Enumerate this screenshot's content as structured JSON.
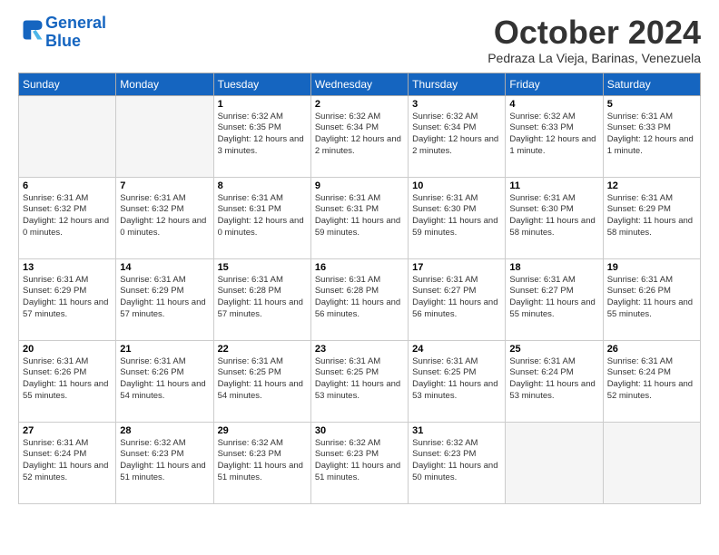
{
  "header": {
    "logo_line1": "General",
    "logo_line2": "Blue",
    "month": "October 2024",
    "location": "Pedraza La Vieja, Barinas, Venezuela"
  },
  "weekdays": [
    "Sunday",
    "Monday",
    "Tuesday",
    "Wednesday",
    "Thursday",
    "Friday",
    "Saturday"
  ],
  "weeks": [
    [
      {
        "day": "",
        "info": ""
      },
      {
        "day": "",
        "info": ""
      },
      {
        "day": "1",
        "info": "Sunrise: 6:32 AM\nSunset: 6:35 PM\nDaylight: 12 hours and 3 minutes."
      },
      {
        "day": "2",
        "info": "Sunrise: 6:32 AM\nSunset: 6:34 PM\nDaylight: 12 hours and 2 minutes."
      },
      {
        "day": "3",
        "info": "Sunrise: 6:32 AM\nSunset: 6:34 PM\nDaylight: 12 hours and 2 minutes."
      },
      {
        "day": "4",
        "info": "Sunrise: 6:32 AM\nSunset: 6:33 PM\nDaylight: 12 hours and 1 minute."
      },
      {
        "day": "5",
        "info": "Sunrise: 6:31 AM\nSunset: 6:33 PM\nDaylight: 12 hours and 1 minute."
      }
    ],
    [
      {
        "day": "6",
        "info": "Sunrise: 6:31 AM\nSunset: 6:32 PM\nDaylight: 12 hours and 0 minutes."
      },
      {
        "day": "7",
        "info": "Sunrise: 6:31 AM\nSunset: 6:32 PM\nDaylight: 12 hours and 0 minutes."
      },
      {
        "day": "8",
        "info": "Sunrise: 6:31 AM\nSunset: 6:31 PM\nDaylight: 12 hours and 0 minutes."
      },
      {
        "day": "9",
        "info": "Sunrise: 6:31 AM\nSunset: 6:31 PM\nDaylight: 11 hours and 59 minutes."
      },
      {
        "day": "10",
        "info": "Sunrise: 6:31 AM\nSunset: 6:30 PM\nDaylight: 11 hours and 59 minutes."
      },
      {
        "day": "11",
        "info": "Sunrise: 6:31 AM\nSunset: 6:30 PM\nDaylight: 11 hours and 58 minutes."
      },
      {
        "day": "12",
        "info": "Sunrise: 6:31 AM\nSunset: 6:29 PM\nDaylight: 11 hours and 58 minutes."
      }
    ],
    [
      {
        "day": "13",
        "info": "Sunrise: 6:31 AM\nSunset: 6:29 PM\nDaylight: 11 hours and 57 minutes."
      },
      {
        "day": "14",
        "info": "Sunrise: 6:31 AM\nSunset: 6:29 PM\nDaylight: 11 hours and 57 minutes."
      },
      {
        "day": "15",
        "info": "Sunrise: 6:31 AM\nSunset: 6:28 PM\nDaylight: 11 hours and 57 minutes."
      },
      {
        "day": "16",
        "info": "Sunrise: 6:31 AM\nSunset: 6:28 PM\nDaylight: 11 hours and 56 minutes."
      },
      {
        "day": "17",
        "info": "Sunrise: 6:31 AM\nSunset: 6:27 PM\nDaylight: 11 hours and 56 minutes."
      },
      {
        "day": "18",
        "info": "Sunrise: 6:31 AM\nSunset: 6:27 PM\nDaylight: 11 hours and 55 minutes."
      },
      {
        "day": "19",
        "info": "Sunrise: 6:31 AM\nSunset: 6:26 PM\nDaylight: 11 hours and 55 minutes."
      }
    ],
    [
      {
        "day": "20",
        "info": "Sunrise: 6:31 AM\nSunset: 6:26 PM\nDaylight: 11 hours and 55 minutes."
      },
      {
        "day": "21",
        "info": "Sunrise: 6:31 AM\nSunset: 6:26 PM\nDaylight: 11 hours and 54 minutes."
      },
      {
        "day": "22",
        "info": "Sunrise: 6:31 AM\nSunset: 6:25 PM\nDaylight: 11 hours and 54 minutes."
      },
      {
        "day": "23",
        "info": "Sunrise: 6:31 AM\nSunset: 6:25 PM\nDaylight: 11 hours and 53 minutes."
      },
      {
        "day": "24",
        "info": "Sunrise: 6:31 AM\nSunset: 6:25 PM\nDaylight: 11 hours and 53 minutes."
      },
      {
        "day": "25",
        "info": "Sunrise: 6:31 AM\nSunset: 6:24 PM\nDaylight: 11 hours and 53 minutes."
      },
      {
        "day": "26",
        "info": "Sunrise: 6:31 AM\nSunset: 6:24 PM\nDaylight: 11 hours and 52 minutes."
      }
    ],
    [
      {
        "day": "27",
        "info": "Sunrise: 6:31 AM\nSunset: 6:24 PM\nDaylight: 11 hours and 52 minutes."
      },
      {
        "day": "28",
        "info": "Sunrise: 6:32 AM\nSunset: 6:23 PM\nDaylight: 11 hours and 51 minutes."
      },
      {
        "day": "29",
        "info": "Sunrise: 6:32 AM\nSunset: 6:23 PM\nDaylight: 11 hours and 51 minutes."
      },
      {
        "day": "30",
        "info": "Sunrise: 6:32 AM\nSunset: 6:23 PM\nDaylight: 11 hours and 51 minutes."
      },
      {
        "day": "31",
        "info": "Sunrise: 6:32 AM\nSunset: 6:23 PM\nDaylight: 11 hours and 50 minutes."
      },
      {
        "day": "",
        "info": ""
      },
      {
        "day": "",
        "info": ""
      }
    ]
  ]
}
